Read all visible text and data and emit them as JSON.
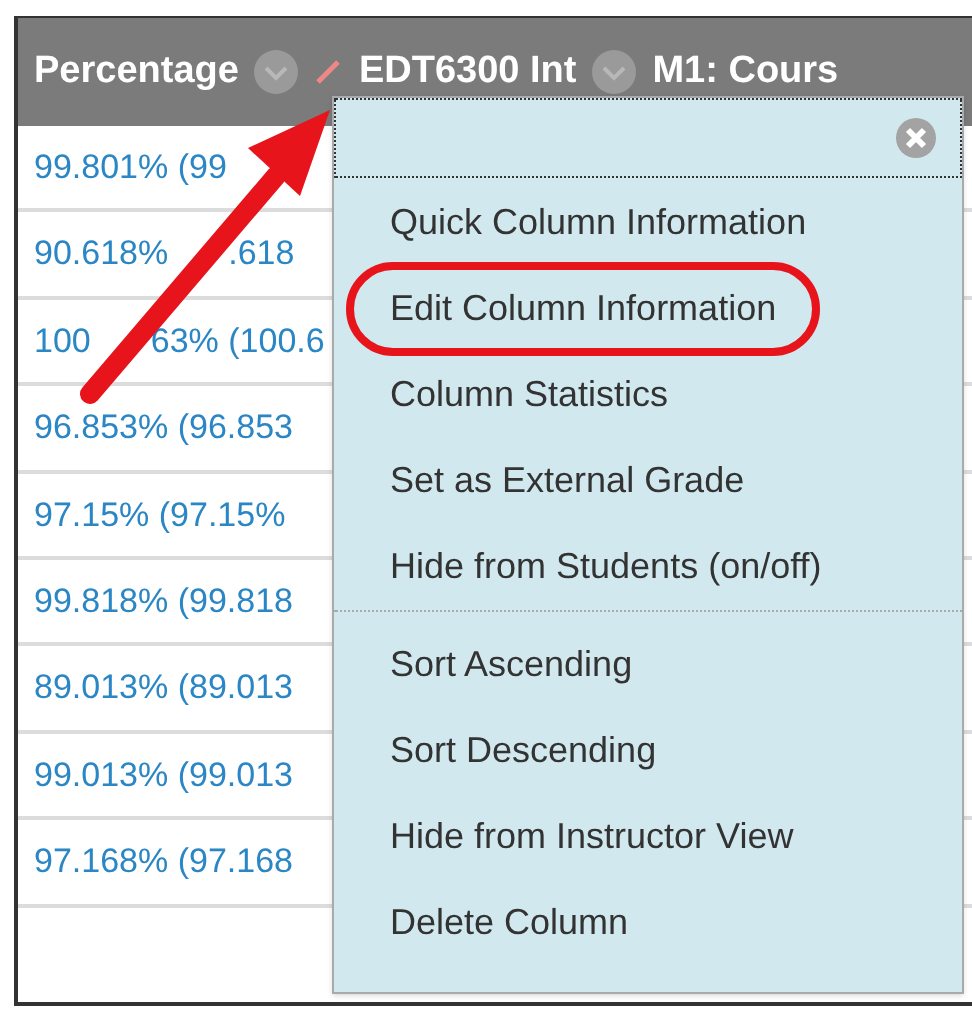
{
  "table": {
    "columns": [
      {
        "label": "Percentage",
        "menu_button": true,
        "edit_icon": false
      },
      {
        "label": "EDT6300 Int",
        "menu_button": true,
        "edit_icon": true
      },
      {
        "label": "M1: Cours",
        "menu_button": false,
        "edit_icon": false
      }
    ],
    "rows": [
      {
        "parts": [
          "99.801% (99"
        ]
      },
      {
        "parts": [
          "90.618%",
          ".618"
        ]
      },
      {
        "parts": [
          "100",
          "63% (100.6"
        ]
      },
      {
        "parts": [
          "96.853% (96.853"
        ]
      },
      {
        "parts": [
          "97.15% (97.15%"
        ]
      },
      {
        "parts": [
          "99.818% (99.818"
        ]
      },
      {
        "parts": [
          "89.013% (89.013"
        ]
      },
      {
        "parts": [
          "99.013% (99.013"
        ]
      },
      {
        "parts": [
          "97.168% (97.168"
        ]
      }
    ]
  },
  "menu": {
    "groups": [
      [
        {
          "label": "Quick Column Information",
          "highlighted": false
        },
        {
          "label": "Edit Column Information",
          "highlighted": true
        },
        {
          "label": "Column Statistics",
          "highlighted": false
        },
        {
          "label": "Set as External Grade",
          "highlighted": false
        },
        {
          "label": "Hide from Students (on/off)",
          "highlighted": false
        }
      ],
      [
        {
          "label": "Sort Ascending",
          "highlighted": false
        },
        {
          "label": "Sort Descending",
          "highlighted": false
        },
        {
          "label": "Hide from Instructor View",
          "highlighted": false
        },
        {
          "label": "Delete Column",
          "highlighted": false
        }
      ]
    ]
  }
}
